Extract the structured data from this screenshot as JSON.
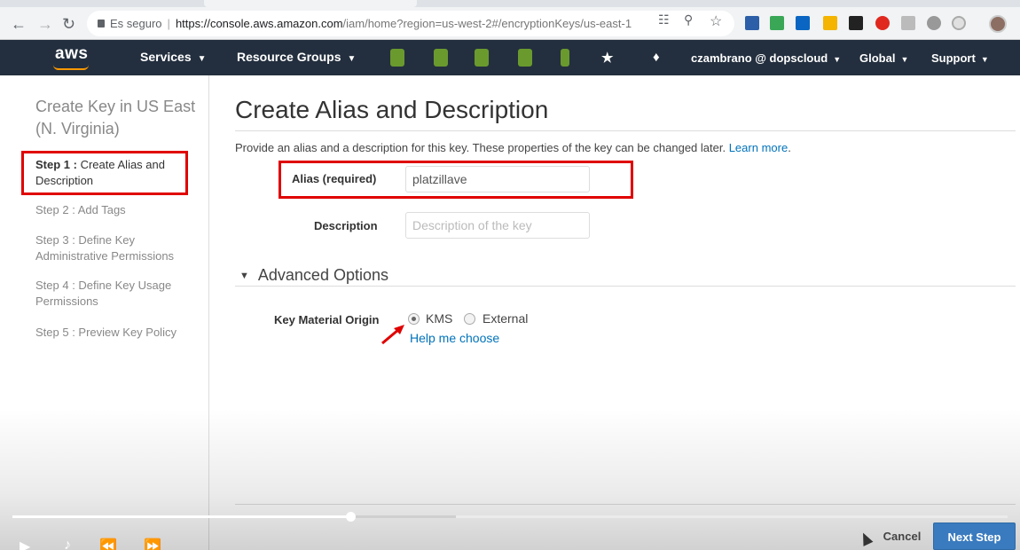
{
  "browser": {
    "secure_label": "Es seguro",
    "url_host": "https://console.aws.amazon.com",
    "url_path": "/iam/home?region=us-west-2#/encryptionKeys/us-east-1"
  },
  "aws_nav": {
    "logo": "aws",
    "services": "Services",
    "resource_groups": "Resource Groups",
    "account": "czambrano @ dopscloud",
    "region": "Global",
    "support": "Support"
  },
  "sidebar": {
    "title": "Create Key in US East (N. Virginia)",
    "steps": [
      {
        "num": "Step 1 :",
        "label": "Create Alias and Description"
      },
      {
        "label": "Step 2 : Add Tags"
      },
      {
        "label": "Step 3 : Define Key Administrative Permissions"
      },
      {
        "label": "Step 4 : Define Key Usage Permissions"
      },
      {
        "label": "Step 5 : Preview Key Policy"
      }
    ]
  },
  "main": {
    "title": "Create Alias and Description",
    "intro": "Provide an alias and a description for this key. These properties of the key can be changed later.",
    "learn_more": "Learn more",
    "learn_more_suffix": ".",
    "alias_label": "Alias (required)",
    "alias_value": "platzillave",
    "description_label": "Description",
    "description_placeholder": "Description of the key",
    "advanced_title": "Advanced Options",
    "key_origin_label": "Key Material Origin",
    "origin_options": [
      "KMS",
      "External"
    ],
    "origin_selected": "KMS",
    "help_link": "Help me choose"
  },
  "footer": {
    "cancel": "Cancel",
    "next": "Next Step"
  },
  "video": {
    "progress_fraction": 0.34
  }
}
